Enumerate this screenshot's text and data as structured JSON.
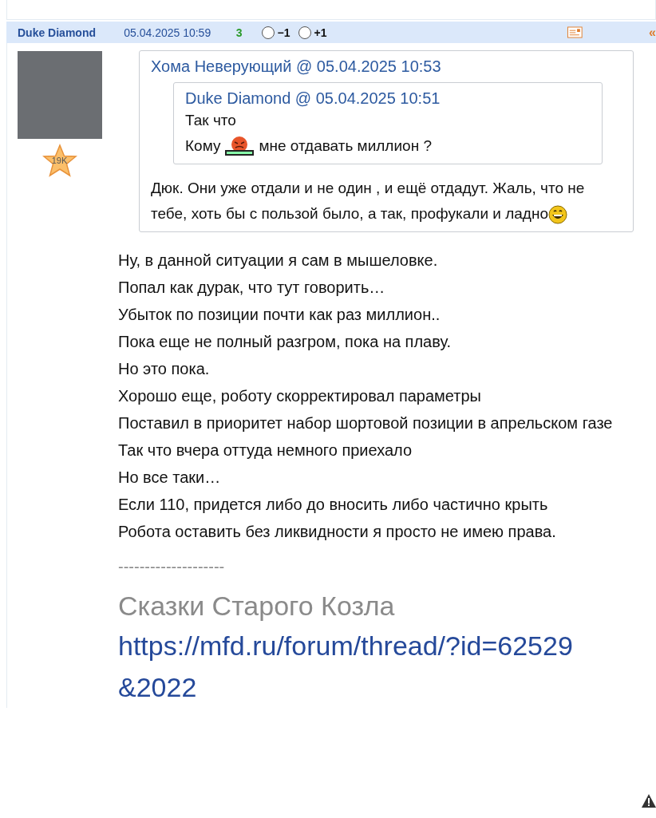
{
  "post": {
    "author": "Duke Diamond",
    "date": "05.04.2025 10:59",
    "rating": "3",
    "votes": [
      {
        "label": "−1",
        "selected": false
      },
      {
        "label": "+1",
        "selected": false
      }
    ],
    "quote_mark": "«",
    "badge": "19K",
    "quote": {
      "author": "Хома Неверующий",
      "at": "@",
      "date": "05.04.2025 10:53",
      "inner": {
        "author": "Duke Diamond",
        "at": "@",
        "date": "05.04.2025 10:51",
        "lines": [
          "Так что"
        ],
        "last_before": "Кому",
        "last_after": "мне отдавать миллион ?"
      },
      "text": "Дюк. Они уже отдали и не один , и ещё отдадут. Жаль, что не тебе, хоть бы с пользой было, а так, профукали и ладно"
    },
    "lines": [
      "Ну, в данной ситуации я сам в мышеловке.",
      "Попал как дурак, что тут говорить…",
      "Убыток по позиции почти как раз миллион..",
      "Пока еще не полный разгром, пока на плаву.",
      "Но это пока.",
      "Хорошо еще, роботу скорректировал параметры",
      "Поставил в приоритет набор шортовой позиции в апрельском газе",
      "Так что вчера оттуда немного приехало",
      "Но все таки…",
      "Если 110, придется либо до вносить либо частично крыть",
      "Робота оставить без ликвидности я просто не имею права."
    ],
    "signature": {
      "rule": "--------------------",
      "title": "Сказки Старого Козла",
      "link": "https://mfd.ru/forum/thread/?id=62529&2022"
    }
  }
}
